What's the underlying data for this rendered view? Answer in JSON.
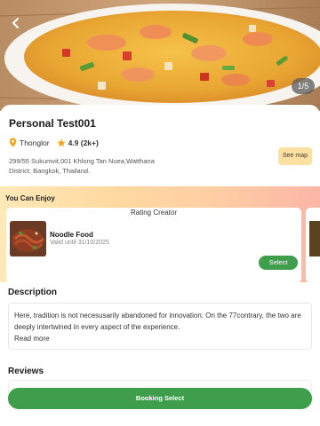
{
  "hero": {
    "image_counter": "1/5",
    "back_icon": "chevron-left-icon"
  },
  "store": {
    "title": "Personal Test001",
    "location": "Thonglor",
    "rating": "4.9 (2k+)",
    "address": "299/55 Sukumvit,001 Khlong Tan Nuea,Watthana District, Bangkok, Thailand.",
    "see_map_label": "See map"
  },
  "enjoy": {
    "title": "You Can Enjoy",
    "coupons": [
      {
        "creator": "Rating Creator",
        "name": "Noodle Food",
        "valid": "Valid until 31/10/2025",
        "select_label": "Select"
      }
    ]
  },
  "description": {
    "title": "Description",
    "text": "Here, tradition is not necesusarily abandoned for innovation. On the 77contrary, the two are deeply intertwined in every aspect of the experience.",
    "read_more": "Read more"
  },
  "reviews": {
    "title": "Reviews"
  },
  "booking": {
    "label": "Booking Select"
  },
  "colors": {
    "accent_green": "#3f9e4b",
    "star": "#f2a516",
    "see_map_bg": "#fbe0a2"
  }
}
